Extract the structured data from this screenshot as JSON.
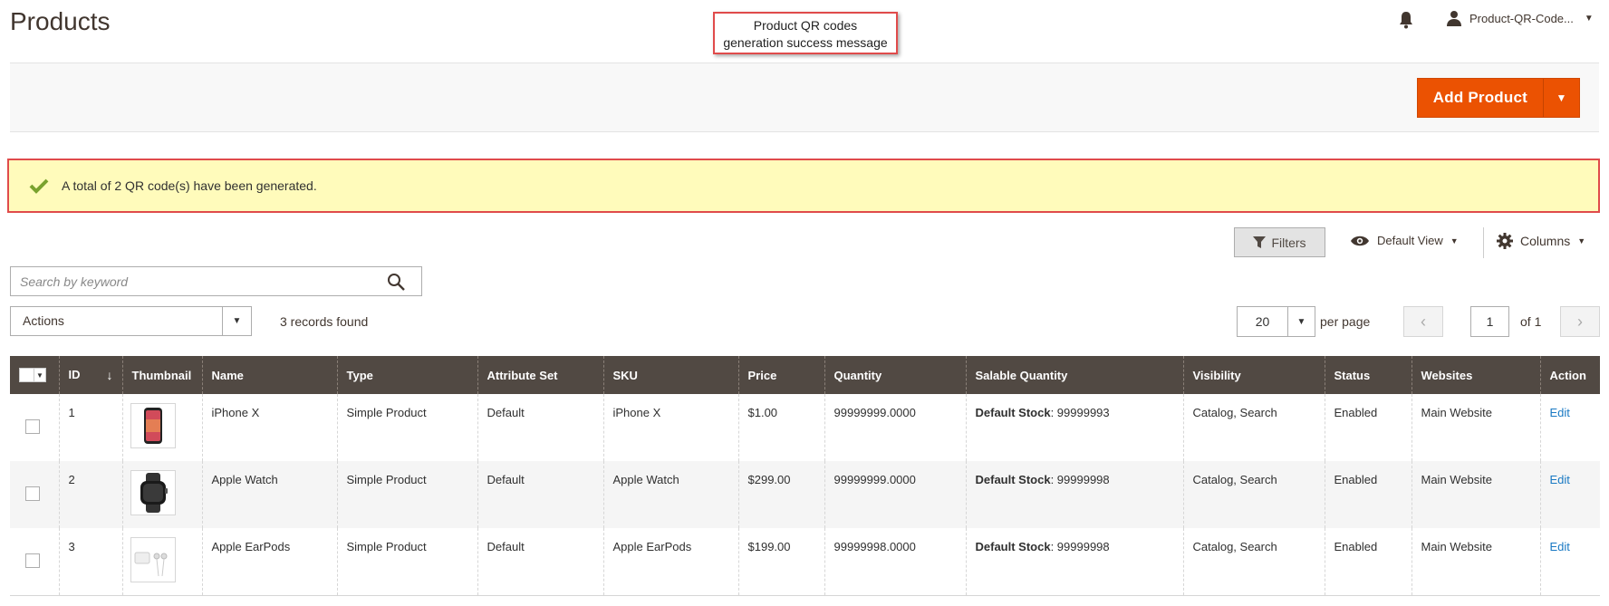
{
  "page": {
    "title": "Products"
  },
  "callout": {
    "line1": "Product QR codes",
    "line2": "generation success message"
  },
  "header": {
    "user_name": "Product-QR-Code..."
  },
  "toolbar": {
    "add_product_label": "Add Product"
  },
  "message": {
    "text": "A total of 2 QR code(s) have been generated."
  },
  "grid_controls": {
    "filters_label": "Filters",
    "view_label": "Default View",
    "columns_label": "Columns",
    "search_placeholder": "Search by keyword",
    "actions_label": "Actions",
    "records_found": "3 records found",
    "per_page_value": "20",
    "per_page_label": "per page",
    "current_page": "1",
    "total_pages_label": "of 1"
  },
  "table": {
    "headers": [
      "ID",
      "Thumbnail",
      "Name",
      "Type",
      "Attribute Set",
      "SKU",
      "Price",
      "Quantity",
      "Salable Quantity",
      "Visibility",
      "Status",
      "Websites",
      "Action"
    ],
    "rows": [
      {
        "id": "1",
        "name": "iPhone X",
        "type": "Simple Product",
        "attribute_set": "Default",
        "sku": "iPhone X",
        "price": "$1.00",
        "quantity": "99999999.0000",
        "salable_label": "Default Stock",
        "salable_value": ": 99999993",
        "visibility": "Catalog, Search",
        "status": "Enabled",
        "websites": "Main Website",
        "action": "Edit",
        "thumb_icon": "phone-thumbnail"
      },
      {
        "id": "2",
        "name": "Apple Watch",
        "type": "Simple Product",
        "attribute_set": "Default",
        "sku": "Apple Watch",
        "price": "$299.00",
        "quantity": "99999999.0000",
        "salable_label": "Default Stock",
        "salable_value": ": 99999998",
        "visibility": "Catalog, Search",
        "status": "Enabled",
        "websites": "Main Website",
        "action": "Edit",
        "thumb_icon": "watch-thumbnail"
      },
      {
        "id": "3",
        "name": "Apple EarPods",
        "type": "Simple Product",
        "attribute_set": "Default",
        "sku": "Apple EarPods",
        "price": "$199.00",
        "quantity": "99999998.0000",
        "salable_label": "Default Stock",
        "salable_value": ": 99999998",
        "visibility": "Catalog, Search",
        "status": "Enabled",
        "websites": "Main Website",
        "action": "Edit",
        "thumb_icon": "earpods-thumbnail"
      }
    ]
  },
  "colors": {
    "accent": "#eb5202",
    "header_bg": "#514943",
    "message_bg": "#fffbbb",
    "link": "#1979c3",
    "highlight_border": "#e04b4b"
  }
}
